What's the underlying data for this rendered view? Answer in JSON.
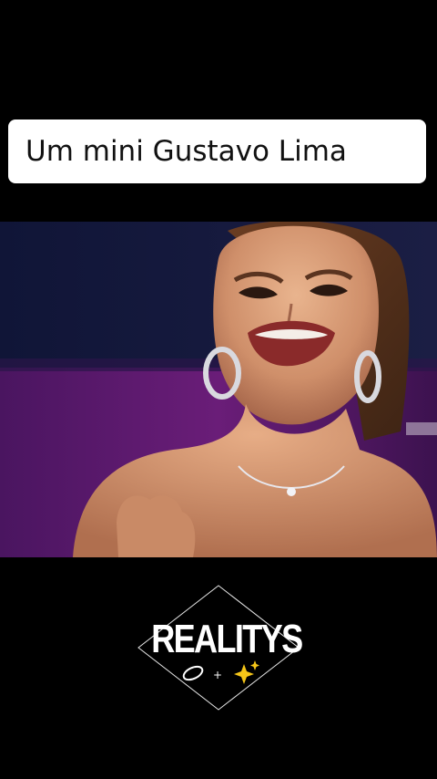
{
  "caption": {
    "text": "Um mini Gustavo Lima"
  },
  "video": {
    "subject": "woman-laughing"
  },
  "logo": {
    "text": "REALITYS"
  },
  "colors": {
    "background": "#000000",
    "caption_bg": "#ffffff",
    "caption_text": "#111111",
    "backdrop_purple": "#5a1a6e",
    "backdrop_navy": "#141a3a"
  }
}
